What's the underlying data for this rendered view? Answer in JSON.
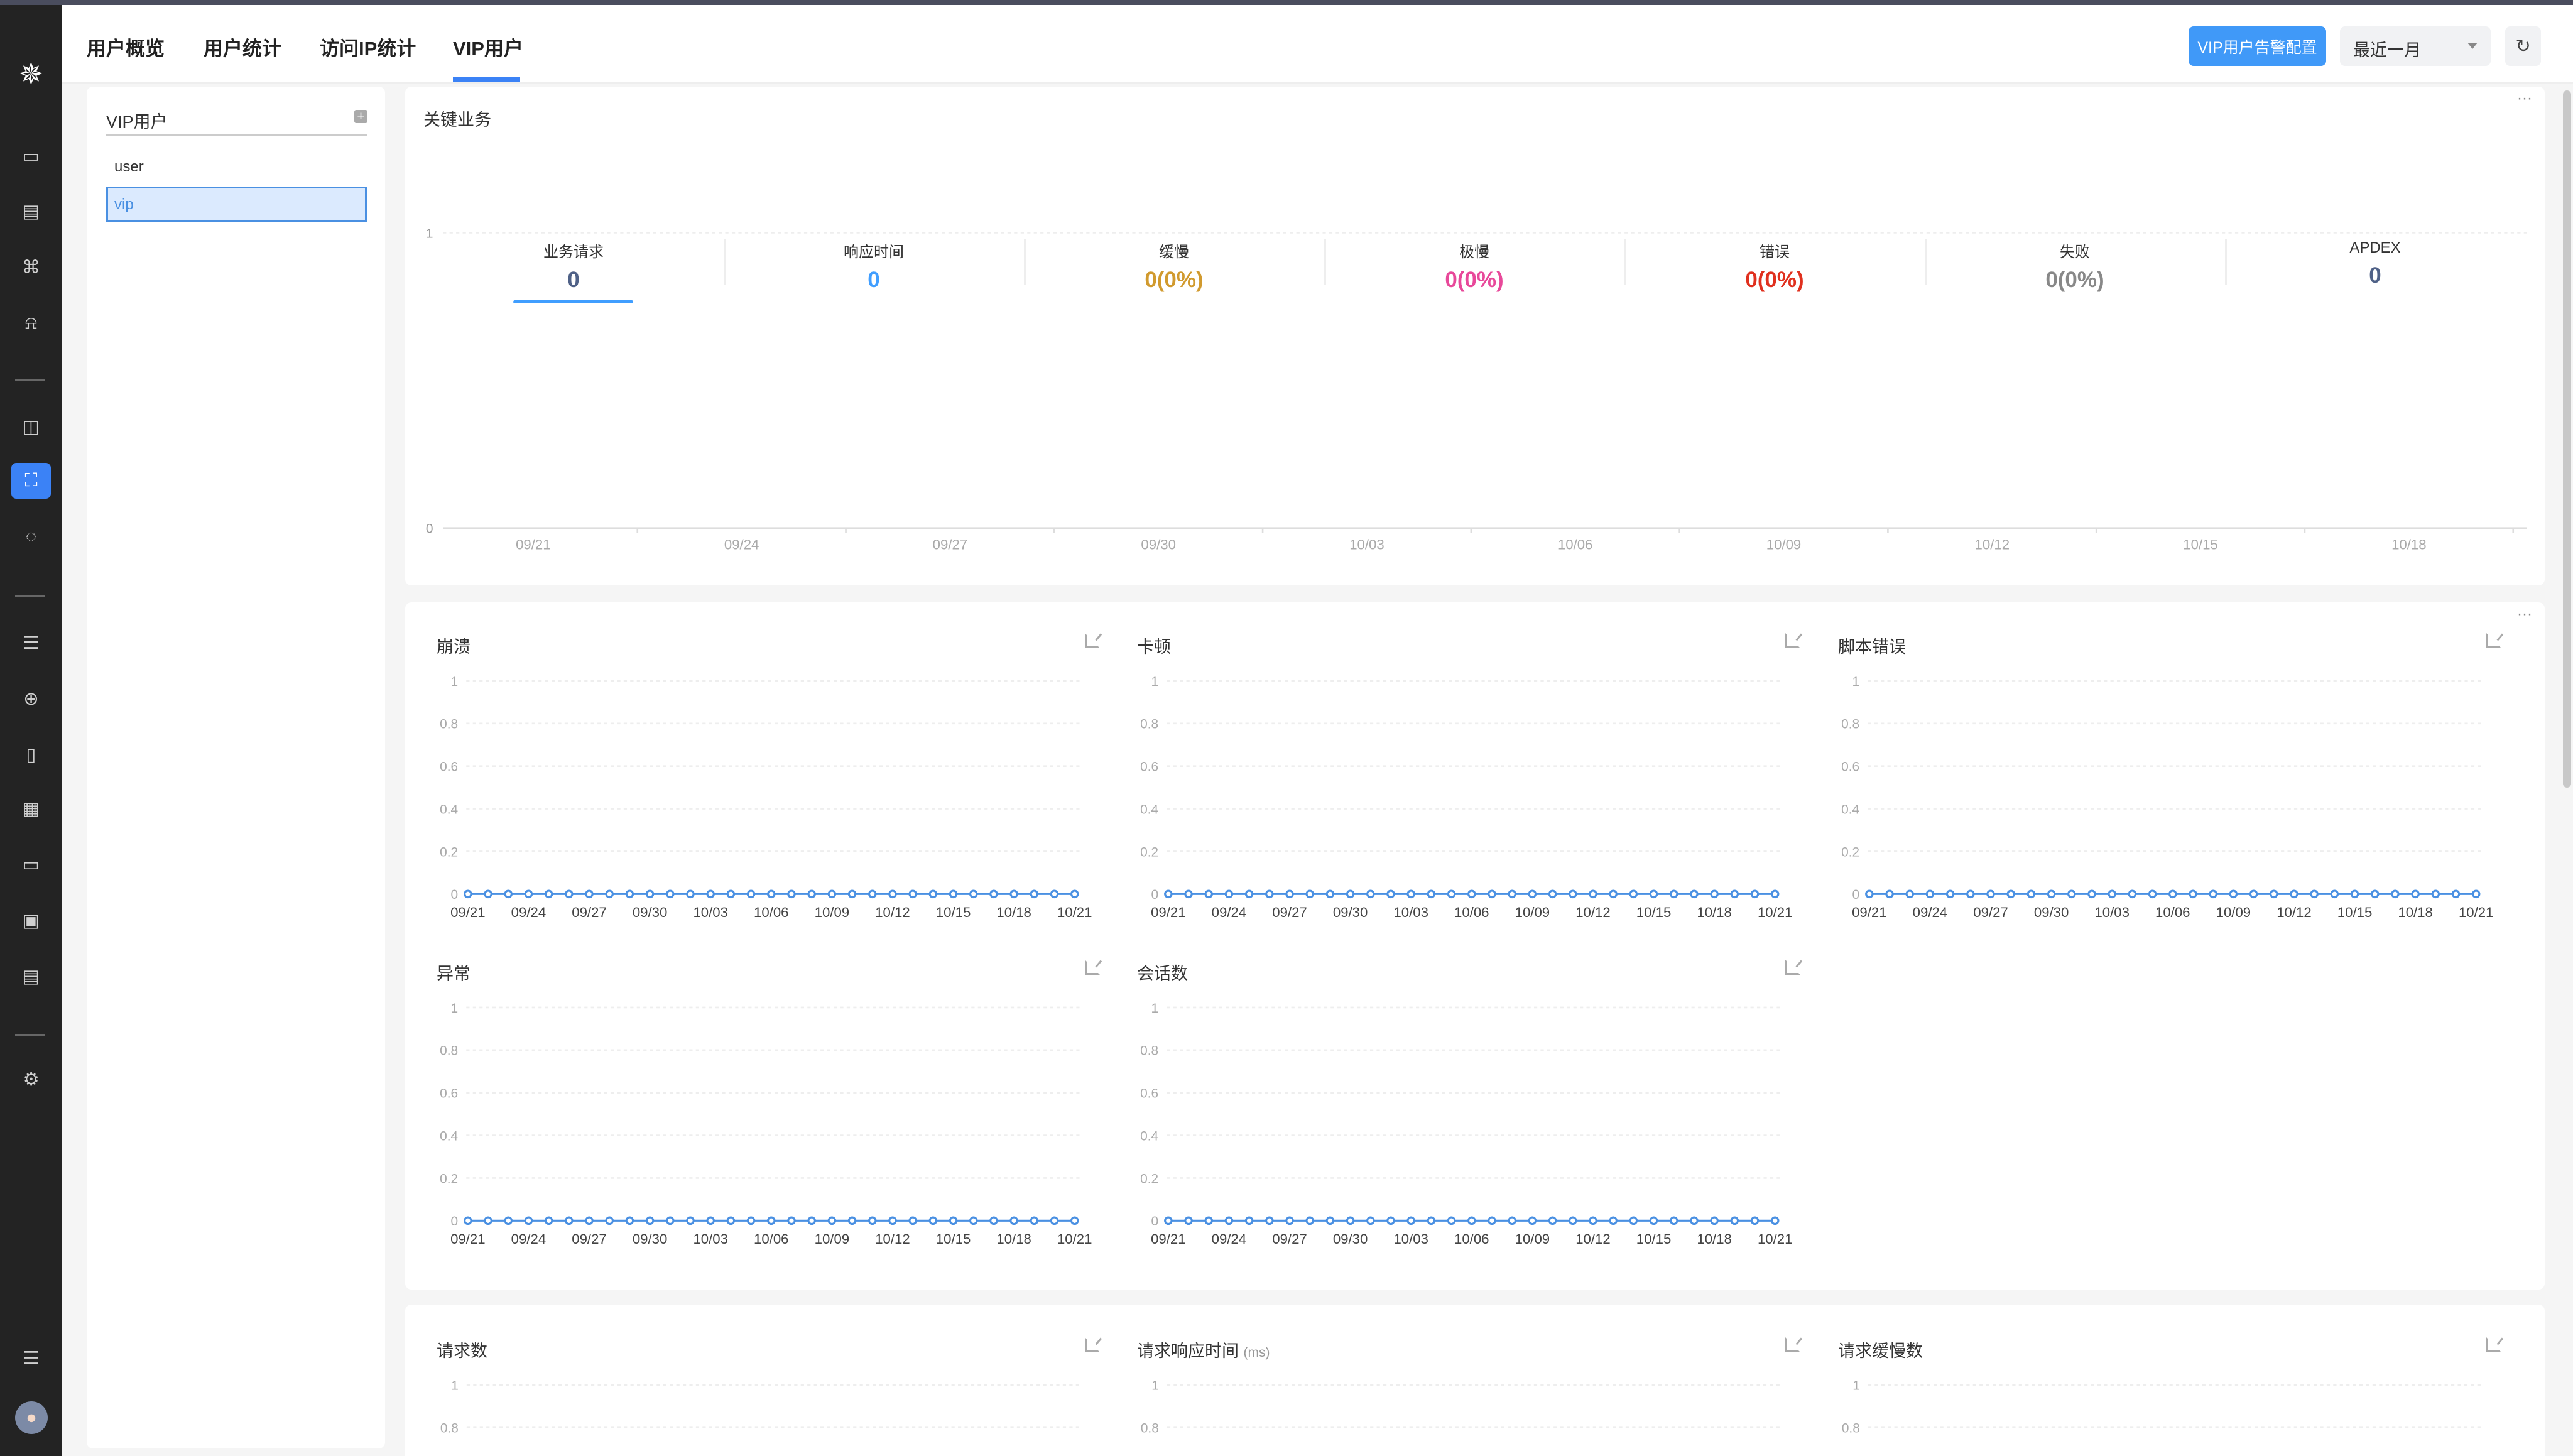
{
  "header": {
    "tabs": [
      {
        "label": "用户概览"
      },
      {
        "label": "用户统计"
      },
      {
        "label": "访问IP统计"
      },
      {
        "label": "VIP用户",
        "active": true
      }
    ],
    "alert_config_button": "VIP用户告警配置",
    "time_range": "最近一月",
    "refresh_icon": "refresh-icon"
  },
  "sidebar": {
    "icons": [
      "logo-icon",
      "dashboard-icon",
      "document-icon",
      "topology-icon",
      "alarm-icon",
      "app-monitor-icon",
      "user-experience-icon",
      "health-icon",
      "server-icon",
      "network-icon",
      "mobile-icon",
      "building-icon",
      "screen-icon",
      "batch-icon",
      "calendar-icon",
      "settings-icon",
      "collapse-menu-icon",
      "user-avatar"
    ],
    "active": "user-experience-icon",
    "accent": "#3b82f6"
  },
  "vip_panel": {
    "title": "VIP用户",
    "add_icon": "plus-icon",
    "items": [
      {
        "label": "user",
        "selected": false
      },
      {
        "label": "vip",
        "selected": true
      }
    ]
  },
  "key_business": {
    "title": "关键业务",
    "metrics": [
      {
        "label": "业务请求",
        "value": "0",
        "color": "#4f6187",
        "active": true
      },
      {
        "label": "响应时间",
        "value": "0",
        "color": "#409eff"
      },
      {
        "label": "缓慢",
        "value": "0(0%)",
        "color": "#d19a2e"
      },
      {
        "label": "极慢",
        "value": "0(0%)",
        "color": "#e8489a"
      },
      {
        "label": "错误",
        "value": "0(0%)",
        "color": "#e0301e"
      },
      {
        "label": "失败",
        "value": "0(0%)",
        "color": "#888888"
      },
      {
        "label": "APDEX",
        "value": "0",
        "color": "#4f6187"
      }
    ]
  },
  "chart_data": [
    {
      "type": "line",
      "title": "关键业务",
      "yticks": [
        "0",
        "1"
      ],
      "ylim": [
        0,
        1
      ],
      "xticks": [
        "09/21",
        "09/24",
        "09/27",
        "09/30",
        "10/03",
        "10/06",
        "10/09",
        "10/12",
        "10/15",
        "10/18"
      ],
      "series": []
    },
    {
      "type": "line",
      "title": "崩溃",
      "ylim": [
        0,
        1
      ],
      "yticks": [
        "0",
        "0.2",
        "0.4",
        "0.6",
        "0.8",
        "1"
      ],
      "xticks": [
        "09/21",
        "09/24",
        "09/27",
        "09/30",
        "10/03",
        "10/06",
        "10/09",
        "10/12",
        "10/15",
        "10/18",
        "10/21"
      ],
      "series": [
        {
          "name": "崩溃",
          "values": [
            0,
            0,
            0,
            0,
            0,
            0,
            0,
            0,
            0,
            0,
            0,
            0,
            0,
            0,
            0,
            0,
            0,
            0,
            0,
            0,
            0,
            0,
            0,
            0,
            0,
            0,
            0,
            0,
            0,
            0,
            0
          ]
        }
      ]
    },
    {
      "type": "line",
      "title": "卡顿",
      "ylim": [
        0,
        1
      ],
      "yticks": [
        "0",
        "0.2",
        "0.4",
        "0.6",
        "0.8",
        "1"
      ],
      "xticks": [
        "09/21",
        "09/24",
        "09/27",
        "09/30",
        "10/03",
        "10/06",
        "10/09",
        "10/12",
        "10/15",
        "10/18",
        "10/21"
      ],
      "series": [
        {
          "name": "卡顿",
          "values": [
            0,
            0,
            0,
            0,
            0,
            0,
            0,
            0,
            0,
            0,
            0,
            0,
            0,
            0,
            0,
            0,
            0,
            0,
            0,
            0,
            0,
            0,
            0,
            0,
            0,
            0,
            0,
            0,
            0,
            0,
            0
          ]
        }
      ]
    },
    {
      "type": "line",
      "title": "脚本错误",
      "ylim": [
        0,
        1
      ],
      "yticks": [
        "0",
        "0.2",
        "0.4",
        "0.6",
        "0.8",
        "1"
      ],
      "xticks": [
        "09/21",
        "09/24",
        "09/27",
        "09/30",
        "10/03",
        "10/06",
        "10/09",
        "10/12",
        "10/15",
        "10/18",
        "10/21"
      ],
      "series": [
        {
          "name": "脚本错误",
          "values": [
            0,
            0,
            0,
            0,
            0,
            0,
            0,
            0,
            0,
            0,
            0,
            0,
            0,
            0,
            0,
            0,
            0,
            0,
            0,
            0,
            0,
            0,
            0,
            0,
            0,
            0,
            0,
            0,
            0,
            0,
            0
          ]
        }
      ]
    },
    {
      "type": "line",
      "title": "异常",
      "ylim": [
        0,
        1
      ],
      "yticks": [
        "0",
        "0.2",
        "0.4",
        "0.6",
        "0.8",
        "1"
      ],
      "xticks": [
        "09/21",
        "09/24",
        "09/27",
        "09/30",
        "10/03",
        "10/06",
        "10/09",
        "10/12",
        "10/15",
        "10/18",
        "10/21"
      ],
      "series": [
        {
          "name": "异常",
          "values": [
            0,
            0,
            0,
            0,
            0,
            0,
            0,
            0,
            0,
            0,
            0,
            0,
            0,
            0,
            0,
            0,
            0,
            0,
            0,
            0,
            0,
            0,
            0,
            0,
            0,
            0,
            0,
            0,
            0,
            0,
            0
          ]
        }
      ]
    },
    {
      "type": "line",
      "title": "会话数",
      "ylim": [
        0,
        1
      ],
      "yticks": [
        "0",
        "0.2",
        "0.4",
        "0.6",
        "0.8",
        "1"
      ],
      "xticks": [
        "09/21",
        "09/24",
        "09/27",
        "09/30",
        "10/03",
        "10/06",
        "10/09",
        "10/12",
        "10/15",
        "10/18",
        "10/21"
      ],
      "series": [
        {
          "name": "会话数",
          "values": [
            0,
            0,
            0,
            0,
            0,
            0,
            0,
            0,
            0,
            0,
            0,
            0,
            0,
            0,
            0,
            0,
            0,
            0,
            0,
            0,
            0,
            0,
            0,
            0,
            0,
            0,
            0,
            0,
            0,
            0,
            0
          ]
        }
      ]
    },
    {
      "type": "line",
      "title": "请求数",
      "ylim": [
        0,
        1
      ],
      "yticks": [
        "0.8",
        "1"
      ],
      "series": []
    },
    {
      "type": "line",
      "title": "请求响应时间",
      "unit": "(ms)",
      "ylim": [
        0,
        1
      ],
      "yticks": [
        "0.8",
        "1"
      ],
      "series": []
    },
    {
      "type": "line",
      "title": "请求缓慢数",
      "ylim": [
        0,
        1
      ],
      "yticks": [
        "0.8",
        "1"
      ],
      "series": []
    }
  ],
  "colors": {
    "line": "#4a90e2",
    "primary_button": "#4099f8"
  }
}
